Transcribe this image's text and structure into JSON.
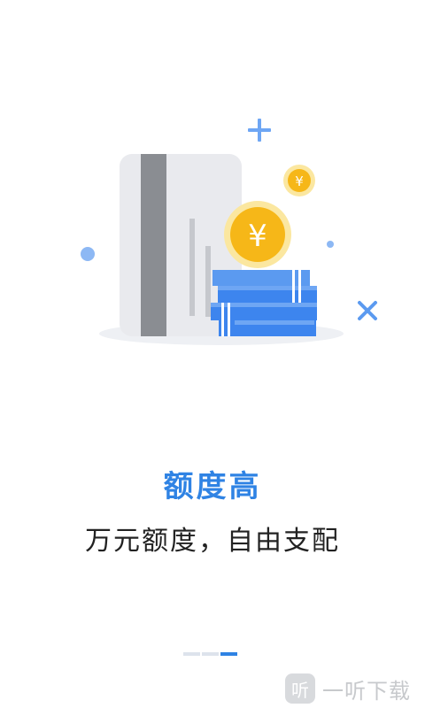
{
  "screen": {
    "title": "额度高",
    "subtitle": "万元额度，自由支配"
  },
  "illustration": {
    "coin_symbol": "¥",
    "colors": {
      "card": "#e9eaee",
      "card_stripe": "#8a8d92",
      "book_blue": "#3d85ee",
      "coin_gold": "#f6b718",
      "coin_glow": "#fbe7a0",
      "accent_blue": "#5b9af0"
    }
  },
  "pager": {
    "total": 3,
    "active_index": 2
  },
  "watermark": {
    "logo_glyph": "听",
    "text": "一听下载"
  }
}
